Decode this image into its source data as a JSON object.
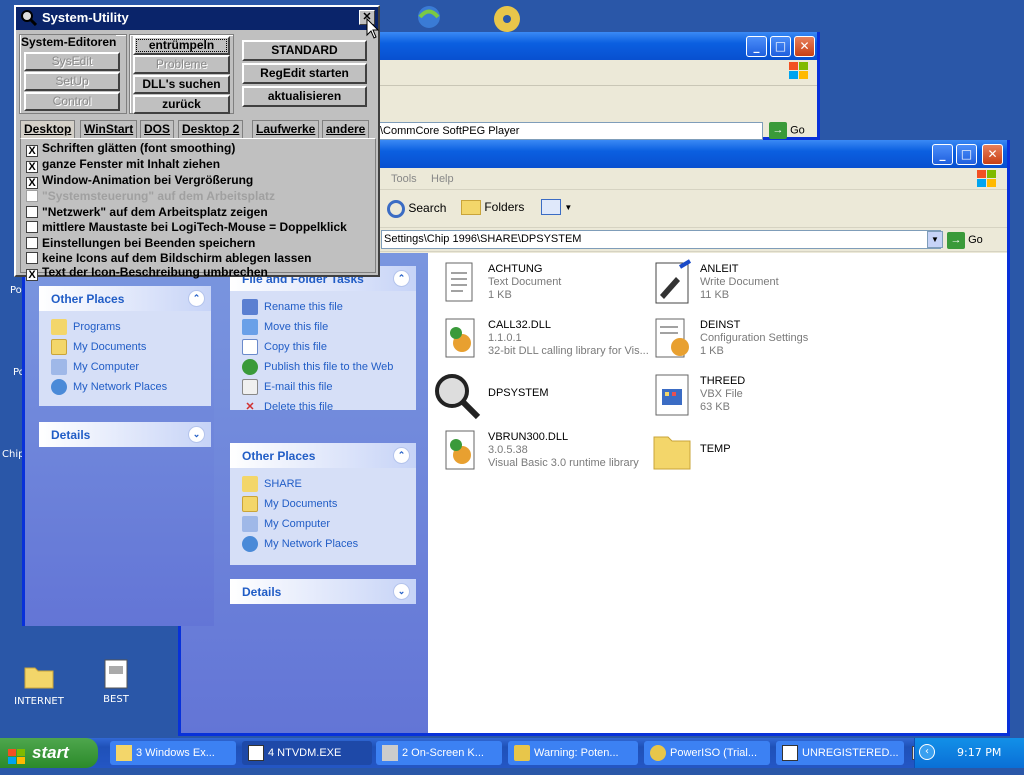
{
  "desktop": {
    "icons": [
      {
        "label": "INTERNET"
      },
      {
        "label": "BEST"
      }
    ],
    "partial_labels": [
      "Po",
      "Po",
      "Chip"
    ]
  },
  "back_window": {
    "address": "\\CommCore SoftPEG Player",
    "go_label": "Go"
  },
  "explorer": {
    "menu": [
      "Tools",
      "Help"
    ],
    "toolbar": {
      "search": "Search",
      "folders": "Folders"
    },
    "address": "Settings\\Chip 1996\\SHARE\\DPSYSTEM",
    "go_label": "Go",
    "file_tasks": {
      "title": "File and Folder Tasks",
      "items": [
        "Rename this file",
        "Move this file",
        "Copy this file",
        "Publish this file to the Web",
        "E-mail this file",
        "Delete this file"
      ]
    },
    "other_places": {
      "title": "Other Places",
      "items": [
        "SHARE",
        "My Documents",
        "My Computer",
        "My Network Places"
      ]
    },
    "details": {
      "title": "Details"
    },
    "files": [
      {
        "name": "ACHTUNG",
        "line1": "Text Document",
        "line2": "1 KB"
      },
      {
        "name": "ANLEIT",
        "line1": "Write Document",
        "line2": "11 KB"
      },
      {
        "name": "CALL32.DLL",
        "line1": "1.1.0.1",
        "line2": "32-bit DLL calling library for Vis..."
      },
      {
        "name": "DEINST",
        "line1": "Configuration Settings",
        "line2": "1 KB"
      },
      {
        "name": "DPSYSTEM",
        "line1": "",
        "line2": ""
      },
      {
        "name": "THREED",
        "line1": "VBX File",
        "line2": "63 KB"
      },
      {
        "name": "VBRUN300.DLL",
        "line1": "3.0.5.38",
        "line2": "Visual Basic 3.0 runtime library"
      },
      {
        "name": "TEMP",
        "line1": "",
        "line2": ""
      }
    ]
  },
  "left_window": {
    "other_places": {
      "title": "Other Places",
      "items": [
        "Programs",
        "My Documents",
        "My Computer",
        "My Network Places"
      ]
    },
    "details": {
      "title": "Details"
    }
  },
  "sysutil": {
    "title": "System-Utility",
    "group_label": "System-Editoren",
    "editors": [
      "SysEdit",
      "SetUp",
      "Control"
    ],
    "mid_buttons": [
      "entrümpeln",
      "Probleme",
      "DLL's suchen",
      "zurück"
    ],
    "right_buttons": [
      "STANDARD",
      "RegEdit starten",
      "aktualisieren"
    ],
    "tabs": [
      "Desktop",
      "WinStart",
      "DOS",
      "Desktop 2",
      "Laufwerke",
      "andere"
    ],
    "options": [
      {
        "label": "Schriften glätten (font smoothing)",
        "checked": "X",
        "disabled": false
      },
      {
        "label": "ganze Fenster mit Inhalt ziehen",
        "checked": "X",
        "disabled": false
      },
      {
        "label": "Window-Animation bei Vergrößerung",
        "checked": "X",
        "disabled": false
      },
      {
        "label": "\"Systemsteuerung\" auf dem Arbeitsplatz",
        "checked": "",
        "disabled": true
      },
      {
        "label": "\"Netzwerk\" auf dem Arbeitsplatz zeigen",
        "checked": "",
        "disabled": false
      },
      {
        "label": "mittlere Maustaste bei LogiTech-Mouse = Doppelklick",
        "checked": "",
        "disabled": false
      },
      {
        "label": "Einstellungen bei Beenden speichern",
        "checked": "",
        "disabled": false
      },
      {
        "label": "keine Icons auf dem Bildschirm ablegen lassen",
        "checked": "",
        "disabled": false
      },
      {
        "label": "Text der Icon-Beschreibung umbrechen",
        "checked": "X",
        "disabled": false
      }
    ]
  },
  "taskbar": {
    "start": "start",
    "buttons": [
      "3 Windows Ex...",
      "4 NTVDM.EXE",
      "2 On-Screen K...",
      "Warning: Poten...",
      "PowerISO (Trial...",
      "UNREGISTERED..."
    ],
    "time": "9:17 PM"
  }
}
